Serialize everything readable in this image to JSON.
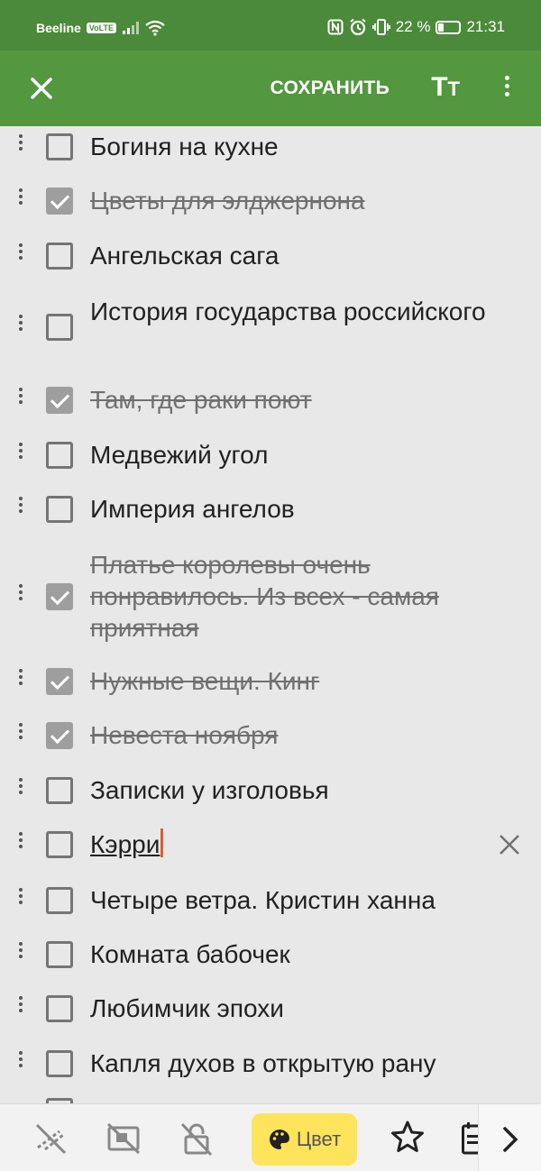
{
  "status_bar": {
    "carrier": "Beeline",
    "volte": "VoLTE",
    "battery": "22 %",
    "battery_level": 0.22,
    "time": "21:31",
    "icons": [
      "signal-icon",
      "wifi-icon",
      "nfc-icon",
      "alarm-icon",
      "vibrate-icon",
      "battery-icon"
    ]
  },
  "toolbar": {
    "close_icon": "close-icon",
    "save_label": "СОХРАНИТЬ",
    "text_size_big": "T",
    "text_size_small": "T",
    "more_icon": "more-vert-icon"
  },
  "checklist": {
    "items": [
      {
        "text": "Богиня на кухне",
        "checked": false
      },
      {
        "text": "Цветы для элджернона",
        "checked": true
      },
      {
        "text": "Ангельская сага",
        "checked": false
      },
      {
        "text": "История государства российского",
        "checked": false
      },
      {
        "text": "Там, где раки поют",
        "checked": true
      },
      {
        "text": "Медвежий угол",
        "checked": false
      },
      {
        "text": "Империя ангелов",
        "checked": false
      },
      {
        "text": "Платье королевы очень понравилось. Из всех - самая приятная",
        "checked": true
      },
      {
        "text": "Нужные вещи. Кинг",
        "checked": true
      },
      {
        "text": "Невеста ноября",
        "checked": true
      },
      {
        "text": "Записки у изголовья",
        "checked": false
      },
      {
        "text": "Кэрри",
        "checked": false,
        "editing": true
      },
      {
        "text": "Четыре ветра. Кристин ханна",
        "checked": false
      },
      {
        "text": "Комната бабочек",
        "checked": false
      },
      {
        "text": "Любимчик эпохи",
        "checked": false
      },
      {
        "text": "Капля духов в открытую рану",
        "checked": false
      }
    ]
  },
  "bottom_bar": {
    "color_label": "Цвет",
    "colors": {
      "color_button_bg": "#ffe45c",
      "accent": "#53973f",
      "caret": "#e65a2e"
    },
    "icons": [
      "no-sync-icon",
      "no-pin-icon",
      "unlock-icon",
      "palette-icon",
      "star-icon",
      "calendar-icon",
      "chevron-right-icon"
    ]
  }
}
